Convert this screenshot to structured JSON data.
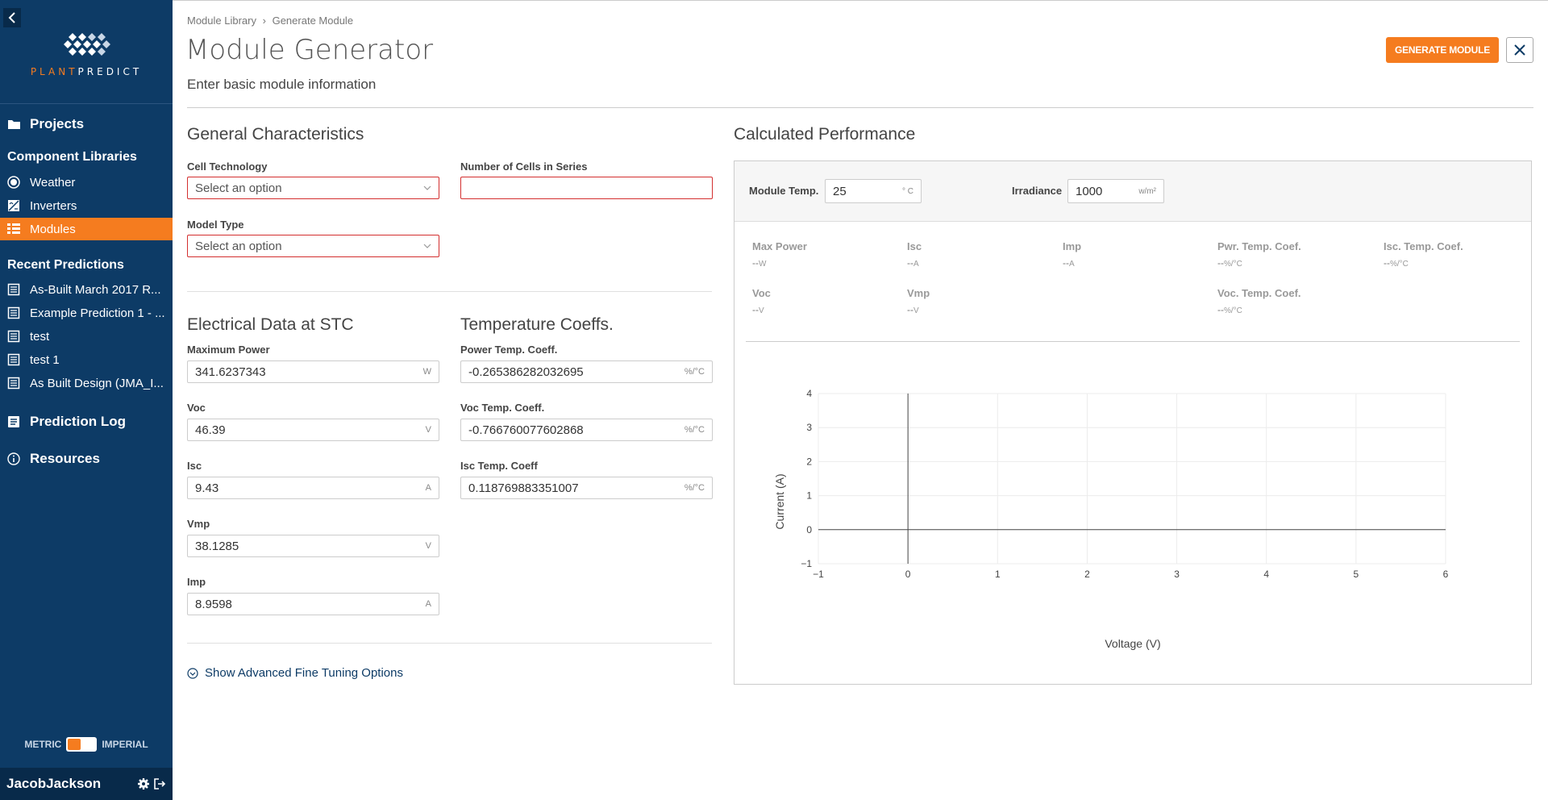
{
  "sidebar": {
    "logo": {
      "text_a": "PLANT",
      "text_b": "PREDICT"
    },
    "projects": "Projects",
    "component_libraries": "Component Libraries",
    "libraries": [
      {
        "label": "Weather",
        "icon": "weather-icon"
      },
      {
        "label": "Inverters",
        "icon": "inverter-icon"
      },
      {
        "label": "Modules",
        "icon": "modules-icon",
        "active": true
      }
    ],
    "recent_predictions": "Recent Predictions",
    "recent": [
      "As-Built March 2017 R...",
      "Example Prediction 1 - ...",
      "test",
      "test 1",
      "As Built Design (JMA_I..."
    ],
    "prediction_log": "Prediction Log",
    "resources": "Resources",
    "unit_metric": "METRIC",
    "unit_imperial": "IMPERIAL",
    "username": "JacobJackson"
  },
  "header": {
    "breadcrumb": [
      "Module Library",
      "Generate Module"
    ],
    "title": "Module Generator",
    "subtitle": "Enter basic module information",
    "generate_label": "GENERATE MODULE"
  },
  "general": {
    "title": "General Characteristics",
    "cell_tech_label": "Cell Technology",
    "cell_tech_value": "Select an option",
    "cells_series_label": "Number of Cells in Series",
    "cells_series_value": "",
    "model_type_label": "Model Type",
    "model_type_value": "Select an option"
  },
  "electrical": {
    "title": "Electrical Data at STC",
    "max_power_label": "Maximum Power",
    "max_power": "341.6237343",
    "max_power_unit": "W",
    "voc_label": "Voc",
    "voc": "46.39",
    "voc_unit": "V",
    "isc_label": "Isc",
    "isc": "9.43",
    "isc_unit": "A",
    "vmp_label": "Vmp",
    "vmp": "38.1285",
    "vmp_unit": "V",
    "imp_label": "Imp",
    "imp": "8.9598",
    "imp_unit": "A"
  },
  "temperature": {
    "title": "Temperature Coeffs.",
    "power_label": "Power Temp. Coeff.",
    "power": "-0.265386282032695",
    "power_unit": "%/°C",
    "voc_label": "Voc Temp. Coeff.",
    "voc": "-0.766760077602868",
    "voc_unit": "%/°C",
    "isc_label": "Isc Temp. Coeff",
    "isc": "0.118769883351007",
    "isc_unit": "%/°C"
  },
  "advanced_link": "Show Advanced Fine Tuning Options",
  "performance": {
    "title": "Calculated Performance",
    "module_temp_label": "Module Temp.",
    "module_temp": "25",
    "module_temp_unit": "° C",
    "irradiance_label": "Irradiance",
    "irradiance": "1000",
    "irradiance_unit": "w/m²",
    "metrics": [
      {
        "label": "Max Power",
        "value": "--",
        "unit": "W"
      },
      {
        "label": "Isc",
        "value": "--",
        "unit": "A"
      },
      {
        "label": "Imp",
        "value": "--",
        "unit": "A"
      },
      {
        "label": "Pwr. Temp. Coef.",
        "value": "--",
        "unit": "%/°C"
      },
      {
        "label": "Isc. Temp. Coef.",
        "value": "--",
        "unit": "%/°C"
      },
      {
        "label": "Voc",
        "value": "--",
        "unit": "V"
      },
      {
        "label": "Vmp",
        "value": "--",
        "unit": "V"
      },
      {
        "label": "Voc. Temp. Coef.",
        "value": "--",
        "unit": "%/°C"
      }
    ]
  },
  "chart_data": {
    "type": "line",
    "xlabel": "Voltage (V)",
    "ylabel": "Current (A)",
    "xlim": [
      -1,
      6
    ],
    "ylim": [
      -1,
      4
    ],
    "x_ticks": [
      "−1",
      "0",
      "1",
      "2",
      "3",
      "4",
      "5",
      "6"
    ],
    "y_ticks": [
      "−1",
      "0",
      "1",
      "2",
      "3",
      "4"
    ],
    "series": [],
    "grid": true
  },
  "colors": {
    "accent": "#f57c1f",
    "sidebar": "#0d3b66",
    "error": "#d32f2f"
  }
}
